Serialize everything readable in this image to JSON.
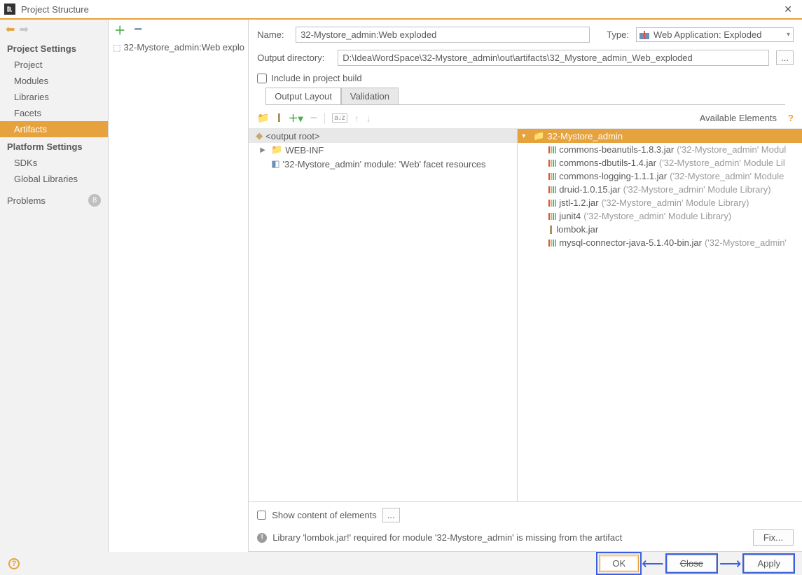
{
  "window": {
    "title": "Project Structure"
  },
  "sidebar": {
    "section1": "Project Settings",
    "items1": [
      "Project",
      "Modules",
      "Libraries",
      "Facets",
      "Artifacts"
    ],
    "selected1": 4,
    "section2": "Platform Settings",
    "items2": [
      "SDKs",
      "Global Libraries"
    ],
    "problems_label": "Problems",
    "problems_count": "8"
  },
  "midlist": {
    "entry": "32-Mystore_admin:Web explo"
  },
  "form": {
    "name_label": "Name:",
    "name_value": "32-Mystore_admin:Web exploded",
    "type_label": "Type:",
    "type_value": "Web Application: Exploded",
    "outdir_label": "Output directory:",
    "outdir_value": "D:\\IdeaWordSpace\\32-Mystore_admin\\out\\artifacts\\32_Mystore_admin_Web_exploded",
    "include_label": "Include in project build",
    "browse": "..."
  },
  "tabs": {
    "t1": "Output Layout",
    "t2": "Validation"
  },
  "available_label": "Available Elements",
  "left_tree": {
    "root": "<output root>",
    "webinf": "WEB-INF",
    "facet": "'32-Mystore_admin' module: 'Web' facet resources"
  },
  "right_tree": {
    "project": "32-Mystore_admin",
    "libs": [
      {
        "name": "commons-beanutils-1.8.3.jar",
        "note": "('32-Mystore_admin' Modul"
      },
      {
        "name": "commons-dbutils-1.4.jar",
        "note": "('32-Mystore_admin' Module Lil"
      },
      {
        "name": "commons-logging-1.1.1.jar",
        "note": "('32-Mystore_admin' Module"
      },
      {
        "name": "druid-1.0.15.jar",
        "note": "('32-Mystore_admin' Module Library)"
      },
      {
        "name": "jstl-1.2.jar",
        "note": "('32-Mystore_admin' Module Library)"
      },
      {
        "name": "junit4",
        "note": "('32-Mystore_admin' Module Library)"
      },
      {
        "name": "lombok.jar",
        "note": ""
      },
      {
        "name": "mysql-connector-java-5.1.40-bin.jar",
        "note": "('32-Mystore_admin'"
      }
    ]
  },
  "show_content_label": "Show content of elements",
  "warning": "Library 'lombok.jar!' required for module '32-Mystore_admin' is missing from the artifact",
  "fix_label": "Fix...",
  "buttons": {
    "ok": "OK",
    "close": "Close",
    "apply": "Apply"
  }
}
